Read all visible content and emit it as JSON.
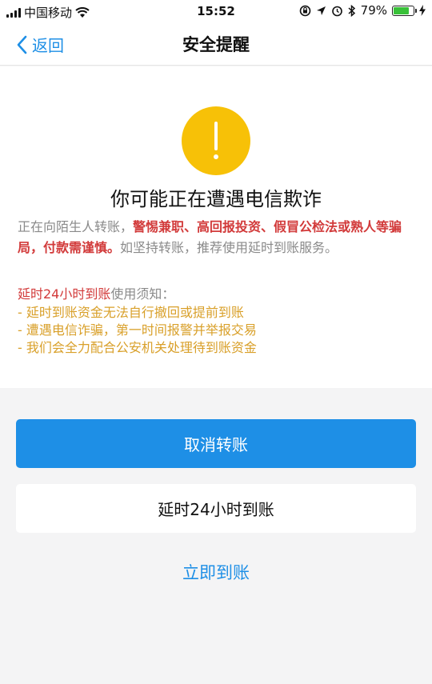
{
  "status_bar": {
    "carrier": "中国移动",
    "time": "15:52",
    "battery_percent": "79%",
    "battery_level": 0.79
  },
  "nav": {
    "back_label": "返回",
    "title": "安全提醒"
  },
  "alert": {
    "icon": "exclamation-icon",
    "headline": "你可能正在遭遇电信欺诈",
    "desc_part1": "正在向陌生人转账，",
    "desc_highlight": "警惕兼职、高回报投资、假冒公检法或熟人等骗局，付款需谨慎。",
    "desc_part2": "如坚持转账，推荐使用延时到账服务。",
    "notice_highlight": "延时24小时到账",
    "notice_suffix": "使用须知：",
    "notice_items": [
      "- 延时到账资金无法自行撤回或提前到账",
      "- 遭遇电信诈骗，第一时间报警并举报交易",
      "- 我们会全力配合公安机关处理待到账资金"
    ]
  },
  "actions": {
    "cancel_label": "取消转账",
    "delay_label": "延时24小时到账",
    "instant_label": "立即到账"
  },
  "colors": {
    "accent": "#1e8fe6",
    "warning": "#f7c107",
    "danger": "#d23a3a",
    "notice": "#d9a02a"
  }
}
